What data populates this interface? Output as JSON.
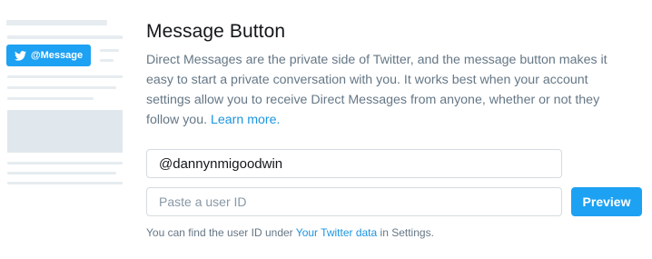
{
  "illustration": {
    "button_label": "@Message"
  },
  "section": {
    "title": "Message Button",
    "description": "Direct Messages are the private side of Twitter, and the message button makes it easy to start a private conversation with you. It works best when your account settings allow you to receive Direct Messages from anyone, whether or not they follow you.",
    "learn_more": "Learn more."
  },
  "form": {
    "screen_name_value": "@dannynmigoodwin",
    "user_id_placeholder": "Paste a user ID",
    "preview_label": "Preview"
  },
  "hint": {
    "prefix": "You can find the user ID under",
    "link": "Your Twitter data",
    "suffix": "in Settings."
  },
  "colors": {
    "accent": "#1da1f2",
    "link": "#1b95e0",
    "muted": "#657786",
    "placeholder_bar": "#e6ecf0"
  }
}
